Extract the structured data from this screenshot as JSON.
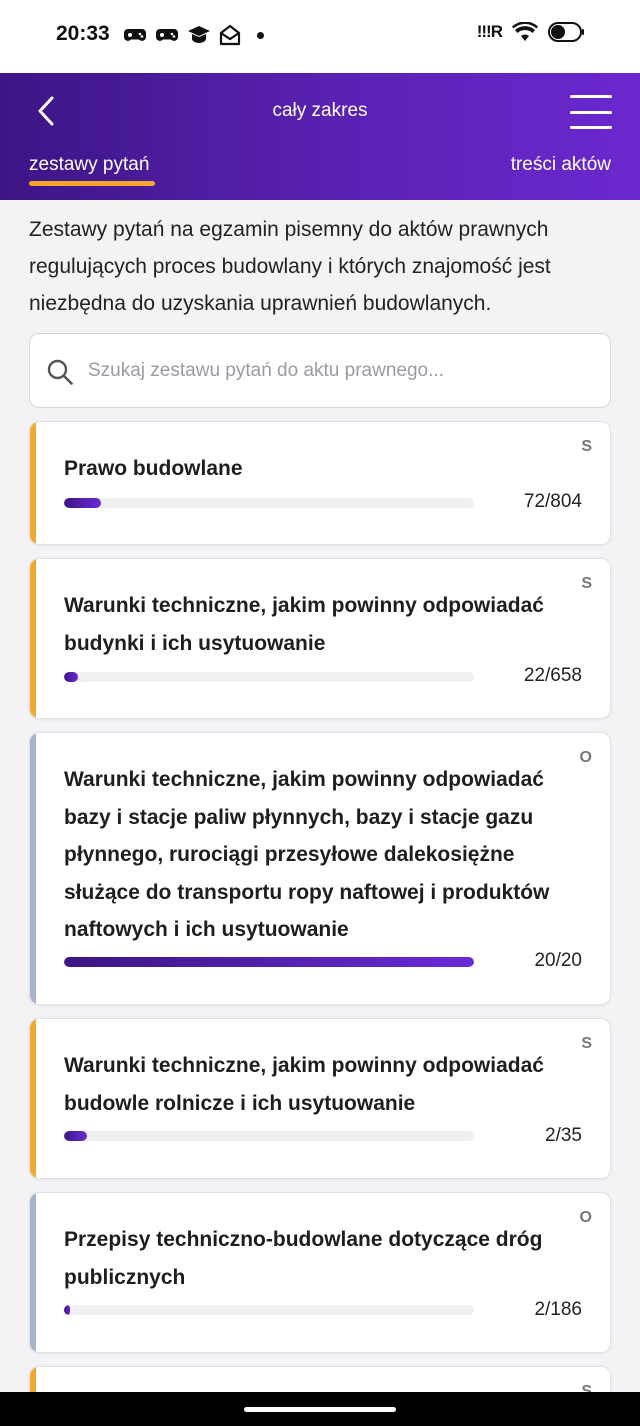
{
  "status_bar": {
    "time": "20:33",
    "icons_left": [
      "gamepad-icon",
      "gamepad-icon",
      "graduation-cap-icon",
      "mail-open-icon"
    ],
    "signal_text": "!!!R",
    "icons_right": [
      "wifi-icon",
      "battery-icon"
    ]
  },
  "header": {
    "title": "cały zakres",
    "tabs": [
      {
        "label": "zestawy pytań",
        "active": true
      },
      {
        "label": "treści aktów",
        "active": false
      }
    ],
    "accent_color": "#f4a52f"
  },
  "intro_text": "Zestawy pytań na egzamin pisemny do aktów prawnych regulujących proces budowlany i których znajomość jest niezbędna do uzyskania uprawnień budowlanych.",
  "search": {
    "placeholder": "Szukaj zestawu pytań do aktu prawnego...",
    "value": ""
  },
  "colors": {
    "stripe_s": "#f2a82f",
    "stripe_o": "#a7b2cc",
    "progress_start": "#3b1682",
    "progress_end": "#6a2ad6"
  },
  "cards": [
    {
      "badge": "S",
      "title": "Prawo budowlane",
      "done": 72,
      "total": 804,
      "count": "72/804"
    },
    {
      "badge": "S",
      "title": "Warunki techniczne, jakim powinny odpowiadać budynki i ich usytuowanie",
      "done": 22,
      "total": 658,
      "count": "22/658"
    },
    {
      "badge": "O",
      "title": "Warunki techniczne, jakim powinny odpowiadać bazy i stacje paliw płynnych, bazy i stacje gazu płynnego, rurociągi przesyłowe dalekosiężne służące do transportu ropy naftowej i produktów naftowych i ich usytuowanie",
      "done": 20,
      "total": 20,
      "count": "20/20"
    },
    {
      "badge": "S",
      "title": "Warunki techniczne, jakim powinny odpowiadać budowle rolnicze i ich usytuowanie",
      "done": 2,
      "total": 35,
      "count": "2/35"
    },
    {
      "badge": "O",
      "title": "Przepisy techniczno-budowlane dotyczące dróg publicznych",
      "done": 2,
      "total": 186,
      "count": "2/186"
    },
    {
      "badge": "S",
      "title": "",
      "done": 0,
      "total": 0,
      "count": ""
    }
  ]
}
